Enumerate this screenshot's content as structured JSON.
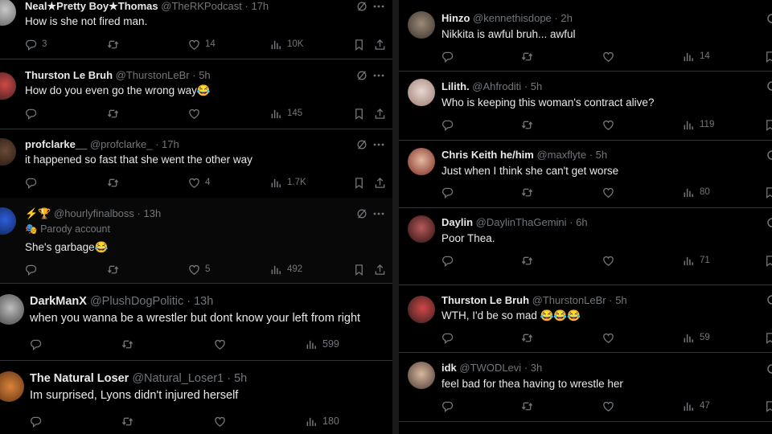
{
  "left_tweets": [
    {
      "name": "Neal★Pretty Boy★Thomas",
      "handle": "@TheRKPodcast",
      "time": "· 17h",
      "text": "How is she not fired man.",
      "replies": "3",
      "likes": "14",
      "views": "10K"
    },
    {
      "name": "Thurston Le Bruh",
      "handle": "@ThurstonLeBr",
      "time": "· 5h",
      "text": "How do you even go the wrong way😂",
      "replies": "",
      "likes": "",
      "views": "145"
    },
    {
      "name": "profclarke__",
      "handle": "@profclarke_",
      "time": "· 17h",
      "text": "it happened so fast that she went the other way",
      "replies": "",
      "likes": "4",
      "views": "1.7K"
    },
    {
      "name": "⚡🏆",
      "handle": "@hourlyfinalboss",
      "time": "· 13h",
      "parody": "Parody account",
      "text": "She's garbage😂",
      "replies": "",
      "likes": "5",
      "views": "492"
    },
    {
      "name": "DarkManX",
      "handle": "@PlushDogPolitic",
      "time": "· 13h",
      "text": "when you wanna be a wrestler but dont know your left from right",
      "replies": "",
      "likes": "",
      "views": "599"
    },
    {
      "name": "The Natural Loser",
      "handle": "@Natural_Loser1",
      "time": "· 5h",
      "text": "Im surprised, Lyons didn't injured herself",
      "replies": "",
      "likes": "",
      "views": "180"
    }
  ],
  "right_tweets": [
    {
      "name": "Hinzo",
      "handle": "@kennethisdope",
      "time": "· 2h",
      "text": "Nikkita is awful bruh... awful",
      "views": "14"
    },
    {
      "name": "Lilith.",
      "handle": "@Ahfroditi",
      "time": "· 5h",
      "text": "Who is keeping this woman's contract alive?",
      "views": "119"
    },
    {
      "name": "Chris Keith he/him",
      "handle": "@maxflyte",
      "time": "· 5h",
      "text": "Just when I think she can't get worse",
      "views": "80"
    },
    {
      "name": "Daylin",
      "handle": "@DaylinThaGemini",
      "time": "· 6h",
      "text": "Poor Thea.",
      "views": "71"
    },
    {
      "name": "Thurston Le Bruh",
      "handle": "@ThurstonLeBr",
      "time": "· 5h",
      "text": "WTH, I'd be so mad 😂😂😂",
      "views": "59"
    },
    {
      "name": "idk",
      "handle": "@TWODLevi",
      "time": "· 3h",
      "text": "feel bad for thea having to wrestle her",
      "views": "47"
    }
  ],
  "icons": {
    "reply": "reply-icon",
    "retweet": "retweet-icon",
    "like": "heart-icon",
    "views": "views-icon",
    "bookmark": "bookmark-icon",
    "share": "share-icon",
    "grok": "grok-icon",
    "more": "more-icon"
  },
  "colors": {
    "background": "#000000",
    "text": "#e7e9ea",
    "secondary": "#71767b",
    "divider": "#2f3336",
    "gap": "#1a1a1a"
  }
}
